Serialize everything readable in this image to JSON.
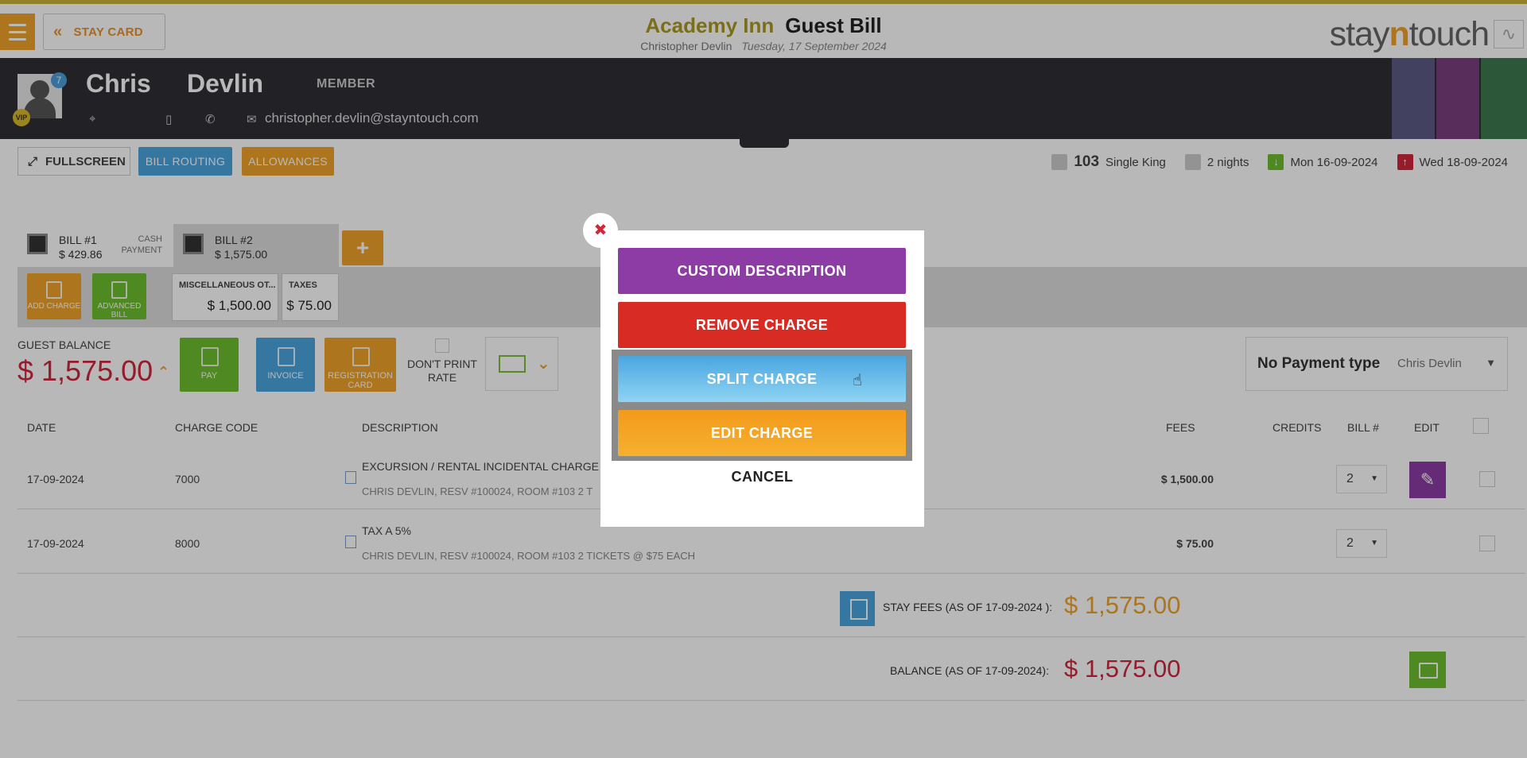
{
  "topbar": {
    "back_label": "STAY CARD",
    "hotel_name": "Academy Inn",
    "doc_title": "Guest Bill",
    "guest_full_name": "Christopher Devlin",
    "date": "Tuesday, 17 September 2024",
    "brand": "stayntouch"
  },
  "guest": {
    "first_name": "Chris",
    "last_name": "Devlin",
    "membership": "MEMBER",
    "email": "christopher.devlin@stayntouch.com",
    "avatar_badge": "7",
    "vip_label": "VIP",
    "side_colors": [
      "#5c5a86",
      "#7b3f7e",
      "#3e7a4f"
    ]
  },
  "toolbar": {
    "fullscreen_label": "FULLSCREEN",
    "bill_routing_label": "BILL ROUTING",
    "allowances_label": "ALLOWANCES"
  },
  "stay": {
    "room_number": "103",
    "room_type": "Single King",
    "nights": "2 nights",
    "arrival": "Mon 16-09-2024",
    "departure": "Wed 18-09-2024"
  },
  "bills": {
    "tabs": [
      {
        "name": "BILL #1",
        "amount": "$ 429.86",
        "payment": "CASH PAYMENT"
      },
      {
        "name": "BILL #2",
        "amount": "$ 1,575.00"
      }
    ],
    "add_charge_label": "ADD CHARGE",
    "advanced_bill_label": "ADVANCED BILL",
    "summary_chips": [
      {
        "label": "MISCELLANEOUS OT...",
        "amount": "$ 1,500.00"
      },
      {
        "label": "TAXES",
        "amount": "$ 75.00"
      }
    ]
  },
  "balance": {
    "label": "GUEST BALANCE",
    "amount": "$ 1,575.00",
    "pay_label": "PAY",
    "invoice_label": "INVOICE",
    "registration_label": "REGISTRATION CARD",
    "dont_print_label": "DON'T PRINT RATE",
    "payment_type": "No Payment type",
    "payer": "Chris Devlin"
  },
  "table": {
    "headers": {
      "date": "DATE",
      "charge_code": "CHARGE CODE",
      "description": "DESCRIPTION",
      "fees": "FEES",
      "credits": "CREDITS",
      "bill_no": "BILL #",
      "edit": "EDIT"
    },
    "rows": [
      {
        "date": "17-09-2024",
        "code": "7000",
        "desc": "EXCURSION / RENTAL INCIDENTAL CHARGE",
        "sub": "CHRIS DEVLIN, RESV #100024, ROOM #103 2 T",
        "fee": "$ 1,500.00",
        "bill": "2"
      },
      {
        "date": "17-09-2024",
        "code": "8000",
        "desc": "TAX A 5%",
        "sub": "CHRIS DEVLIN, RESV #100024, ROOM #103 2 TICKETS @ $75 EACH",
        "fee": "$ 75.00",
        "bill": "2"
      }
    ],
    "stay_fees_label": "STAY FEES (AS OF  17-09-2024 ):",
    "stay_fees_amount": "$ 1,575.00",
    "balance_label": "BALANCE (AS OF  17-09-2024):",
    "balance_amount": "$ 1,575.00"
  },
  "modal": {
    "close": "✖",
    "custom_description": "CUSTOM DESCRIPTION",
    "remove_charge": "REMOVE CHARGE",
    "split_charge": "SPLIT CHARGE",
    "edit_charge": "EDIT CHARGE",
    "cancel": "CANCEL"
  }
}
